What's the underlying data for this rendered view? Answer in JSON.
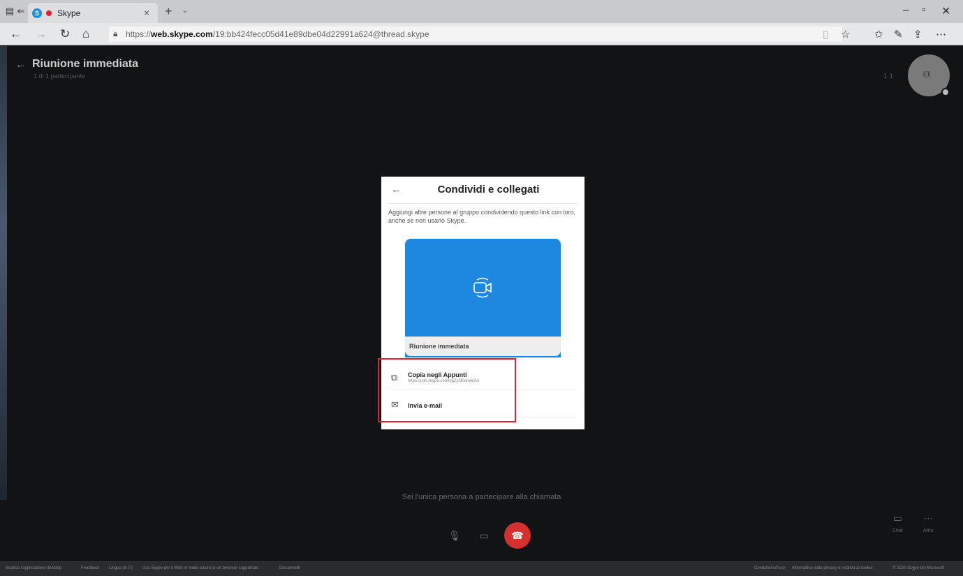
{
  "browser": {
    "tab_title": "Skype",
    "tab_favicon": "S",
    "url_prefix": "https://",
    "url_domain": "web.skype.com",
    "url_path": "/19:bb424fecc05d41e89dbe04d22991a624@thread.skype"
  },
  "header": {
    "title": "Riunione immediata",
    "subtitle": "1 di 1 partecipante",
    "participant_count": "1 1"
  },
  "modal": {
    "title": "Condividi e collegati",
    "description": "Aggiungi altre persone al gruppo condividendo questo link con loro, anche se non usano Skype.",
    "card_label": "Riunione immediata",
    "copy_label": "Copia negli Appunti",
    "copy_link": "https://join.skype.com/qqZyOhaIw6dVi",
    "email_label": "Invia e-mail"
  },
  "call": {
    "status": "Sei l'unica persona a partecipare alla chiamata",
    "chat_label": "Chat",
    "more_label": "Altro"
  },
  "footer": {
    "left": [
      "Scarica l'applicazione desktop",
      "Feedback",
      "Lingua (it-IT)",
      "Usa Skype per il Web in modo sicuro in un browser supportato",
      "Disconnetti"
    ],
    "right": [
      "Condizioni d'uso",
      "Informativa sulla privacy e relativa ai cookie",
      "© 2020 Skype e/o Microsoft"
    ]
  },
  "colors": {
    "card_blue": "#1e88e0",
    "hangup_red": "#d53030",
    "highlight_red": "#e0202a"
  }
}
